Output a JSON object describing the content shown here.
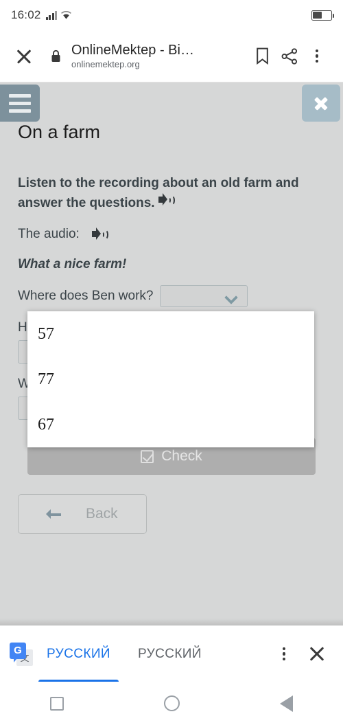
{
  "status_bar": {
    "time": "16:02",
    "signal_icon": "cellular-signal-icon",
    "wifi_icon": "wifi-icon",
    "battery_icon": "battery-icon",
    "battery_level": "44%"
  },
  "browser": {
    "close_icon": "close-icon",
    "lock_icon": "lock-icon",
    "title": "OnlineMektep - Bi…",
    "url": "onlinemektep.org",
    "bookmark_icon": "bookmark-icon",
    "share_icon": "share-icon",
    "overflow_icon": "more-vertical-icon"
  },
  "page": {
    "menu_icon": "hamburger-menu-icon",
    "close_icon": "close-icon",
    "title": "On a farm",
    "instruction": "Listen to the recording about an old farm and answer the questions.",
    "instruction_audio_icon": "speaker-icon",
    "audio_label": "The audio:",
    "audio_icon": "speaker-icon",
    "transcript_heading": "What a nice farm!",
    "questions": [
      {
        "text": "Where does Ben work?",
        "select_value": "",
        "select_icon": "chevron-down-icon"
      },
      {
        "text": "H",
        "select_value": "",
        "select_icon": "chevron-down-icon"
      },
      {
        "text": "W",
        "text_tail": "?",
        "select_value": "",
        "select_icon": "chevron-down-icon"
      }
    ],
    "check_button": {
      "label": "Check",
      "icon": "checkbox-icon"
    },
    "back_button": {
      "label": "Back",
      "icon": "arrow-left-icon"
    }
  },
  "dropdown": {
    "options": [
      "57",
      "77",
      "67"
    ]
  },
  "translate_bar": {
    "icon": "google-translate-icon",
    "tabs": [
      {
        "label": "РУССКИЙ",
        "active": true
      },
      {
        "label": "РУССКИЙ",
        "active": false
      }
    ],
    "overflow_icon": "more-vertical-icon",
    "close_icon": "close-icon"
  },
  "nav_bar": {
    "recents_icon": "square-icon",
    "home_icon": "circle-icon",
    "back_icon": "triangle-back-icon"
  },
  "colors": {
    "page_bg": "#d6d7d7",
    "menu_bg": "#7d919c",
    "close_bg": "#a6bcc7",
    "accent_blue": "#1a73e8",
    "text": "#3b4449"
  }
}
